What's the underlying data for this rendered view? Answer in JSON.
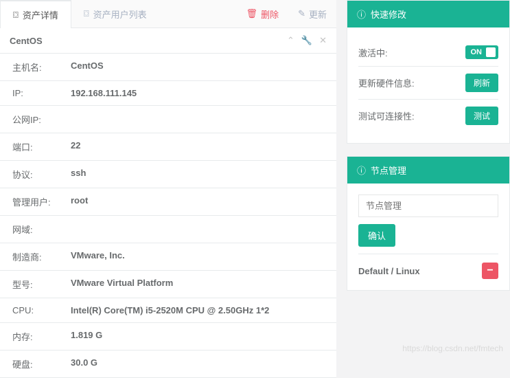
{
  "tabs": {
    "detail": "资产详情",
    "userlist": "资产用户列表"
  },
  "actions": {
    "delete": "删除",
    "update": "更新"
  },
  "panel_title": "CentOS",
  "details": [
    {
      "label": "主机名:",
      "value": "CentOS"
    },
    {
      "label": "IP:",
      "value": "192.168.111.145"
    },
    {
      "label": "公网IP:",
      "value": ""
    },
    {
      "label": "端口:",
      "value": "22"
    },
    {
      "label": "协议:",
      "value": "ssh"
    },
    {
      "label": "管理用户:",
      "value": "root"
    },
    {
      "label": "网域:",
      "value": ""
    },
    {
      "label": "制造商:",
      "value": "VMware, Inc."
    },
    {
      "label": "型号:",
      "value": "VMware Virtual Platform"
    },
    {
      "label": "CPU:",
      "value": "Intel(R) Core(TM) i5-2520M CPU @ 2.50GHz 1*2"
    },
    {
      "label": "内存:",
      "value": "1.819 G"
    },
    {
      "label": "硬盘:",
      "value": "30.0 G"
    }
  ],
  "quick": {
    "title": "快速修改",
    "active_label": "激活中:",
    "active_state": "ON",
    "refresh_hw_label": "更新硬件信息:",
    "refresh_btn": "刷新",
    "test_conn_label": "测试可连接性:",
    "test_btn": "测试"
  },
  "node": {
    "title": "节点管理",
    "placeholder": "节点管理",
    "confirm": "确认",
    "entry_label": "Default / Linux"
  },
  "watermark": "https://blog.csdn.net/fmtech"
}
